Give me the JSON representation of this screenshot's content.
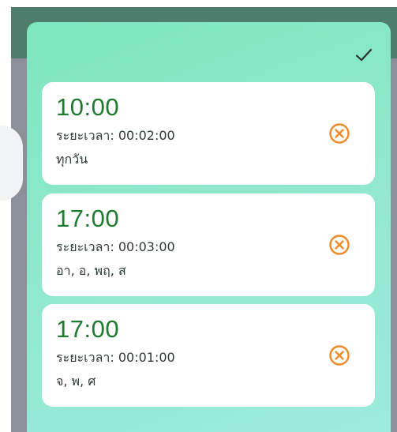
{
  "colors": {
    "accent_green": "#1e7a2e",
    "delete_orange": "#ef8a2b",
    "panel_gradient_start": "#7de6bf",
    "panel_gradient_end": "#9decdf"
  },
  "header": {
    "confirm_icon": "checkmark-icon"
  },
  "schedules": [
    {
      "time": "10:00",
      "duration": "ระยะเวลา: 00:02:00",
      "days": "ทุกวัน",
      "delete_icon": "circle-x-icon"
    },
    {
      "time": "17:00",
      "duration": "ระยะเวลา: 00:03:00",
      "days": "อา, อ, พฤ, ส",
      "delete_icon": "circle-x-icon"
    },
    {
      "time": "17:00",
      "duration": "ระยะเวลา: 00:01:00",
      "days": "จ, พ, ศ",
      "delete_icon": "circle-x-icon"
    }
  ]
}
